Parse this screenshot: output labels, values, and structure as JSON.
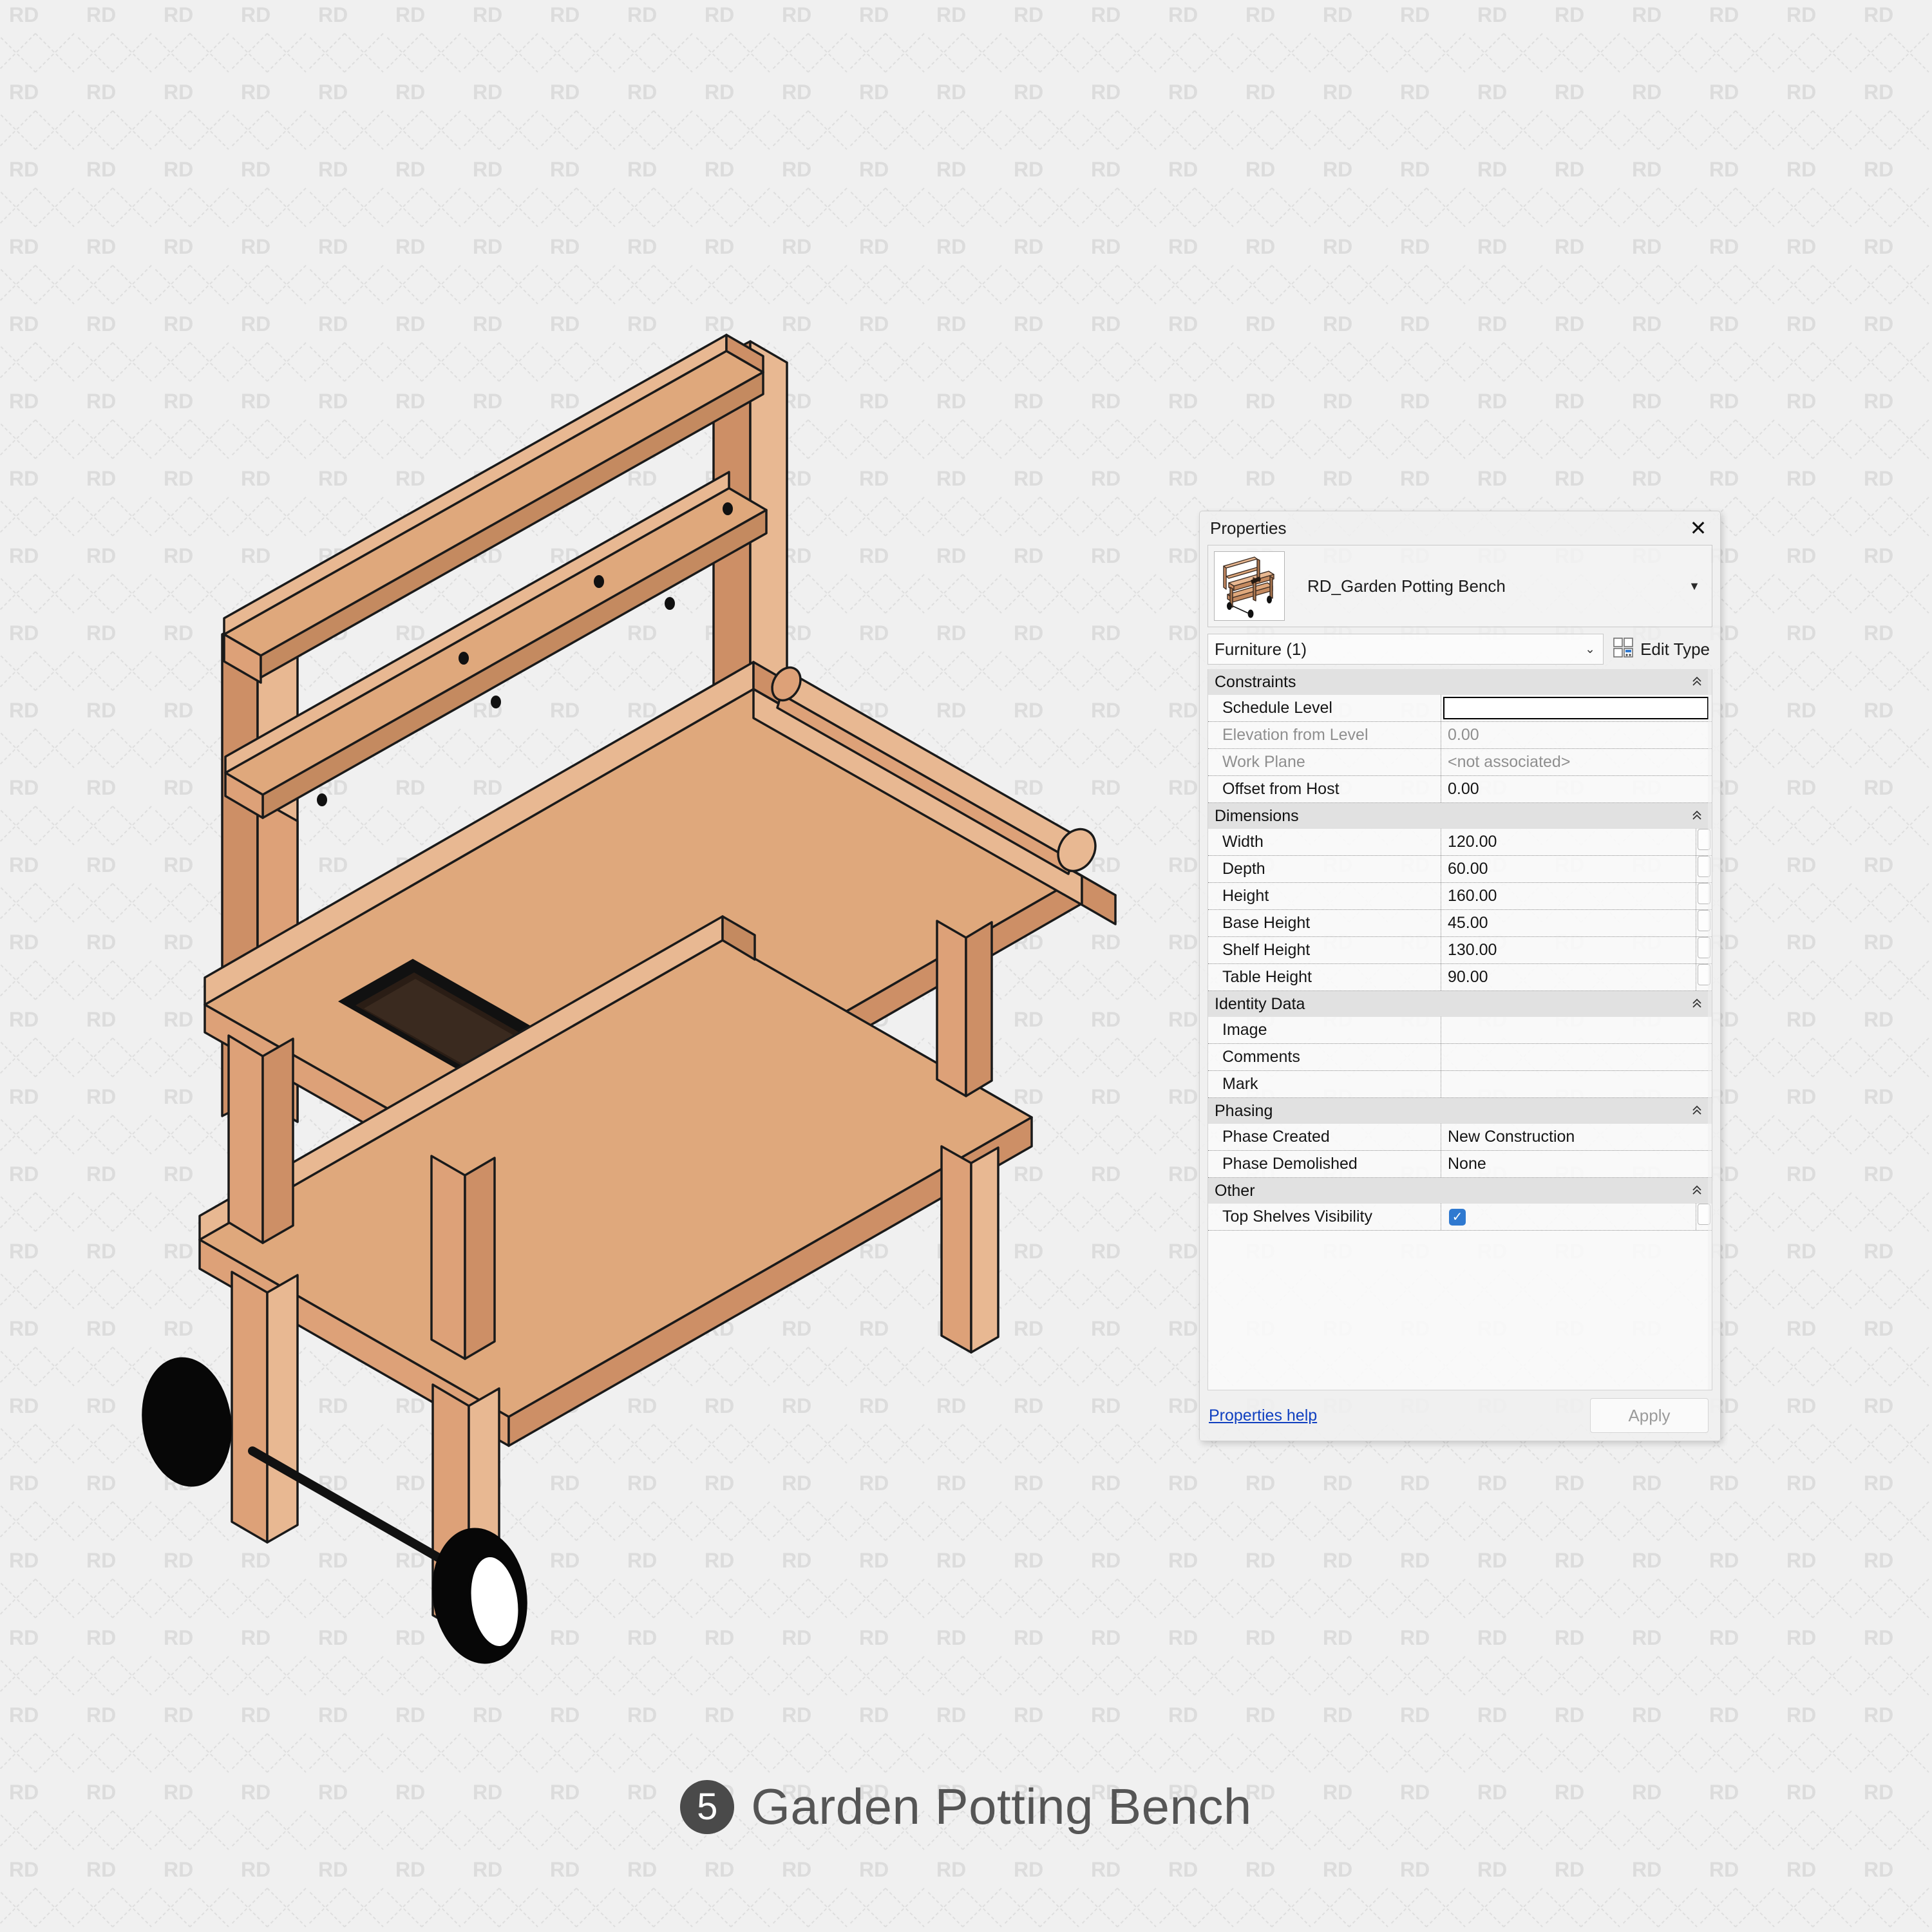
{
  "caption": {
    "number": "5",
    "title": "Garden Potting Bench"
  },
  "watermark": {
    "text": "RD"
  },
  "properties_panel": {
    "title": "Properties",
    "close_icon": "close-icon",
    "type_name": "RD_Garden Potting Bench",
    "type_dropdown_icon": "chevron-down-icon",
    "category": "Furniture (1)",
    "category_caret_icon": "chevron-down-icon",
    "edit_type_label": "Edit Type",
    "edit_type_icon": "edit-type-icon",
    "groups": [
      {
        "name": "Constraints",
        "collapse_icon": "chevron-up-icon",
        "rows": [
          {
            "key": "Schedule Level",
            "value": "",
            "dim": false,
            "editing": true,
            "stepper": false
          },
          {
            "key": "Elevation from Level",
            "value": "0.00",
            "dim": true,
            "editing": false,
            "stepper": false
          },
          {
            "key": "Work Plane",
            "value": "<not associated>",
            "dim": true,
            "editing": false,
            "stepper": false
          },
          {
            "key": "Offset from Host",
            "value": "0.00",
            "dim": false,
            "editing": false,
            "stepper": false
          }
        ]
      },
      {
        "name": "Dimensions",
        "collapse_icon": "chevron-up-icon",
        "rows": [
          {
            "key": "Width",
            "value": "120.00",
            "dim": false,
            "editing": false,
            "stepper": true
          },
          {
            "key": "Depth",
            "value": "60.00",
            "dim": false,
            "editing": false,
            "stepper": true
          },
          {
            "key": "Height",
            "value": "160.00",
            "dim": false,
            "editing": false,
            "stepper": true
          },
          {
            "key": "Base Height",
            "value": "45.00",
            "dim": false,
            "editing": false,
            "stepper": true
          },
          {
            "key": "Shelf Height",
            "value": "130.00",
            "dim": false,
            "editing": false,
            "stepper": true
          },
          {
            "key": "Table Height",
            "value": "90.00",
            "dim": false,
            "editing": false,
            "stepper": true
          }
        ]
      },
      {
        "name": "Identity Data",
        "collapse_icon": "chevron-up-icon",
        "rows": [
          {
            "key": "Image",
            "value": "",
            "dim": false,
            "editing": false,
            "stepper": false
          },
          {
            "key": "Comments",
            "value": "",
            "dim": false,
            "editing": false,
            "stepper": false
          },
          {
            "key": "Mark",
            "value": "",
            "dim": false,
            "editing": false,
            "stepper": false
          }
        ]
      },
      {
        "name": "Phasing",
        "collapse_icon": "chevron-up-icon",
        "rows": [
          {
            "key": "Phase Created",
            "value": "New Construction",
            "dim": false,
            "editing": false,
            "stepper": false
          },
          {
            "key": "Phase Demolished",
            "value": "None",
            "dim": false,
            "editing": false,
            "stepper": false
          }
        ]
      },
      {
        "name": "Other",
        "collapse_icon": "chevron-up-icon",
        "rows": [
          {
            "key": "Top Shelves Visibility",
            "value": "",
            "checked": true,
            "dim": false,
            "editing": false,
            "stepper": true
          }
        ]
      }
    ],
    "help_link": "Properties help",
    "apply_label": "Apply"
  },
  "colors": {
    "background": "#f0f0f0",
    "wood_top": "#dfa87c",
    "wood_light": "#e8b892",
    "wood_mid": "#dda178",
    "wood_dark": "#cd8f66",
    "wood_shadow": "#c08458",
    "outline": "#1a1a1a",
    "accent_checkbox": "#2f79d0",
    "link": "#1040c0",
    "caption_badge": "#4a4a4a",
    "caption_text": "#555555",
    "wheel": "#000000",
    "watermark": "#dcdcdc"
  },
  "model": {
    "name": "garden-potting-bench-3d",
    "parts": [
      "back-top-shelf",
      "back-lower-shelf",
      "back-post-left",
      "back-post-right",
      "table-top",
      "table-side-rail",
      "handle-bar",
      "opening-cutout",
      "lower-shelf",
      "leg-front-left",
      "leg-front-right",
      "leg-back-left",
      "leg-back-right",
      "wheel-left",
      "wheel-right",
      "axle-bar"
    ]
  }
}
